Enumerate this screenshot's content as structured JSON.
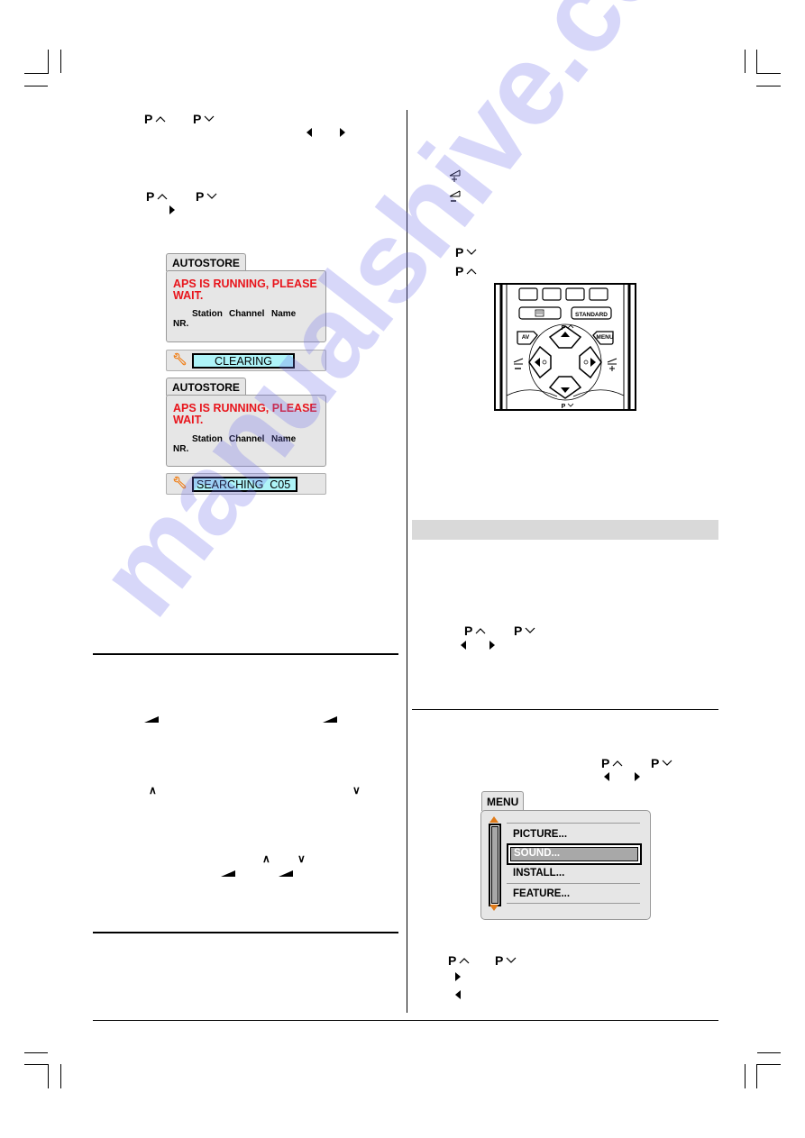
{
  "watermark": {
    "text": "manualshive.com",
    "color": "#8c8cf0"
  },
  "left_column": {
    "step1": {
      "key_up": "P",
      "key_down": "P",
      "arrows": [
        "left-arrow",
        "right-arrow"
      ]
    },
    "step2": {
      "key_up": "P",
      "key_down": "P",
      "arrows": [
        "right-arrow"
      ]
    },
    "osd_screens": [
      {
        "tab": "AUTOSTORE",
        "message_line1": "APS IS RUNNING, PLEASE",
        "message_line2": "WAIT.",
        "columns": [
          "Station",
          "Channel",
          "Name"
        ],
        "nr_label": "NR.",
        "status": "CLEARING"
      },
      {
        "tab": "AUTOSTORE",
        "message_line1": "APS IS RUNNING, PLEASE",
        "message_line2": "WAIT.",
        "columns": [
          "Station",
          "Channel",
          "Name"
        ],
        "nr_label": "NR.",
        "status": "SEARCHING  C05"
      }
    ],
    "colors": {
      "osd_bg": "#e6e6e6",
      "alert_red": "#e8141b",
      "status_field": "#aef4f8",
      "wrench": "#f07d14"
    }
  },
  "right_column": {
    "volume_icons": [
      "volume-up-icon",
      "volume-down-icon"
    ],
    "program_keys": [
      {
        "label": "P",
        "dir": "down"
      },
      {
        "label": "P",
        "dir": "up"
      }
    ],
    "remote": {
      "buttons": {
        "teletext": "teletext-icon",
        "standard": "STANDARD",
        "av": "AV",
        "menu": "MENU",
        "p_up": "P",
        "p_down": "P"
      }
    },
    "section_band_color": "#d9d9d9",
    "step3": {
      "key_up": "P",
      "key_down": "P"
    },
    "step4": {
      "key_up": "P",
      "key_down": "P"
    },
    "menu_osd": {
      "tab": "MENU",
      "items": [
        "PICTURE...",
        "SOUND...",
        "INSTALL...",
        "FEATURE..."
      ],
      "selected_index": 1,
      "colors": {
        "selected_bg": "#a8a8a8",
        "scroll_arrow": "#e07b1a"
      }
    },
    "step5": {
      "key_up": "P",
      "key_down": "P"
    }
  }
}
